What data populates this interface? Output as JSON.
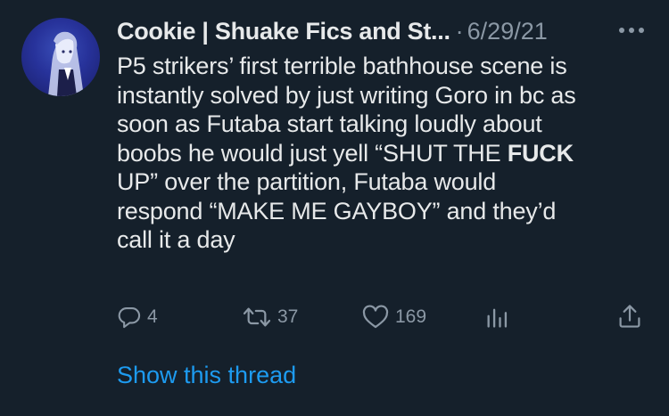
{
  "author": {
    "name": "Cookie | Shuake Fics and St...",
    "separator": "·",
    "date": "6/29/21"
  },
  "tweet": {
    "lines": [
      [
        "P5 strikers’ first terrible bathhouse scene is"
      ],
      [
        "instantly solved by just writing Goro in bc as"
      ],
      [
        "soon as Futaba start talking loudly about"
      ],
      [
        "boobs he would just yell “SHUT THE ",
        "FUCK"
      ],
      [
        "UP” over the partition, Futaba would"
      ],
      [
        "respond “MAKE ME GAYBOY” and they’d"
      ],
      [
        "call it a day"
      ]
    ]
  },
  "actions": {
    "replies": "4",
    "retweets": "37",
    "likes": "169"
  },
  "thread_link": "Show this thread",
  "colors": {
    "background": "#15202b",
    "text": "#e7e9ea",
    "muted": "#8b98a5",
    "link": "#1d9bf0"
  },
  "icons": [
    "more-icon",
    "reply-icon",
    "retweet-icon",
    "like-icon",
    "analytics-icon",
    "share-icon"
  ]
}
